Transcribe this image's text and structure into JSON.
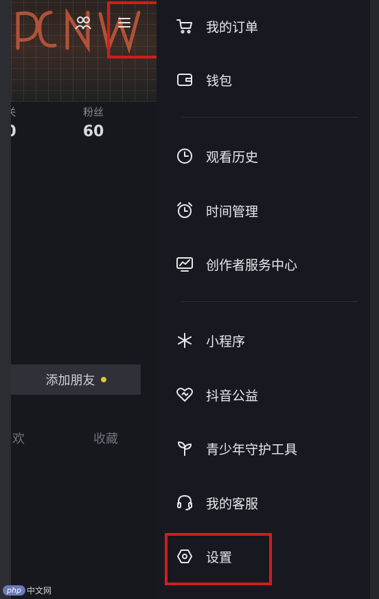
{
  "profile": {
    "stats": {
      "following_num": "0",
      "following_label": "关",
      "fans_label": "粉丝",
      "fans_num": "60"
    },
    "add_friend_label": "添加朋友",
    "tabs": {
      "likes": "欢",
      "favorites": "收藏"
    }
  },
  "drawer": {
    "items": [
      {
        "label": "我的订单",
        "icon": "cart-icon"
      },
      {
        "label": "钱包",
        "icon": "wallet-icon"
      },
      {
        "label": "观看历史",
        "icon": "clock-icon"
      },
      {
        "label": "时间管理",
        "icon": "alarm-clock-icon"
      },
      {
        "label": "创作者服务中心",
        "icon": "chart-monitor-icon"
      },
      {
        "label": "小程序",
        "icon": "asterisk-icon"
      },
      {
        "label": "抖音公益",
        "icon": "heart-icon"
      },
      {
        "label": "青少年守护工具",
        "icon": "sprout-icon"
      },
      {
        "label": "我的客服",
        "icon": "headset-icon"
      },
      {
        "label": "设置",
        "icon": "settings-hexagon-icon"
      }
    ]
  },
  "watermark": {
    "badge": "php",
    "text": "中文网"
  },
  "colors": {
    "drawer_bg": "#181920",
    "highlight_red": "#d11d1d",
    "notice_dot": "#e2c437"
  }
}
